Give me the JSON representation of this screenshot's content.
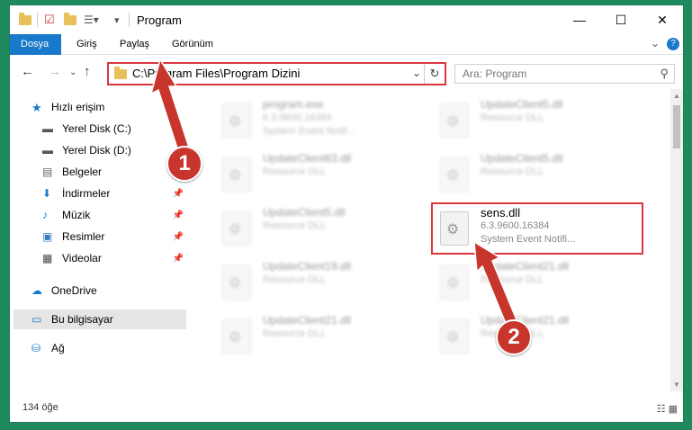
{
  "window": {
    "title": "Program"
  },
  "ribbon": {
    "tabs": [
      "Dosya",
      "Giriş",
      "Paylaş",
      "Görünüm"
    ],
    "help": "?"
  },
  "navigation": {
    "address": "C:\\Program Files\\Program Dizini",
    "search_placeholder": "Ara: Program"
  },
  "sidebar": {
    "quick_access": "Hızlı erişim",
    "items": [
      "Yerel Disk (C:)",
      "Yerel Disk (D:)",
      "Belgeler",
      "İndirmeler",
      "Müzik",
      "Resimler",
      "Videolar"
    ],
    "onedrive": "OneDrive",
    "this_pc": "Bu bilgisayar",
    "network": "Ağ"
  },
  "files": [
    {
      "name": "program.exe",
      "version": "6.3.9600.16384",
      "desc": "System Event Notif..."
    },
    {
      "name": "UpdateClient5.dll",
      "version": "Resource DLL",
      "desc": ""
    },
    {
      "name": "UpdateClient63.dll",
      "version": "Resource DLL",
      "desc": ""
    },
    {
      "name": "UpdateClient5.dll",
      "version": "Resource DLL",
      "desc": ""
    },
    {
      "name": "UpdateClient5.dll",
      "version": "Resource DLL",
      "desc": ""
    },
    {
      "name": "sens.dll",
      "version": "6.3.9600.16384",
      "desc": "System Event Notifi..."
    },
    {
      "name": "UpdateClient19.dll",
      "version": "Resource DLL",
      "desc": ""
    },
    {
      "name": "UpdateClient21.dll",
      "version": "Resource DLL",
      "desc": ""
    },
    {
      "name": "UpdateClient21.dll",
      "version": "Resource DLL",
      "desc": ""
    },
    {
      "name": "UpdateClient21.dll",
      "version": "Resource DLL",
      "desc": ""
    }
  ],
  "status": {
    "count": "134 öğe"
  },
  "annotations": {
    "step1": "1",
    "step2": "2"
  },
  "colors": {
    "accent": "#1979ca",
    "highlight": "#d9363e",
    "desktop": "#1e8a5e"
  }
}
